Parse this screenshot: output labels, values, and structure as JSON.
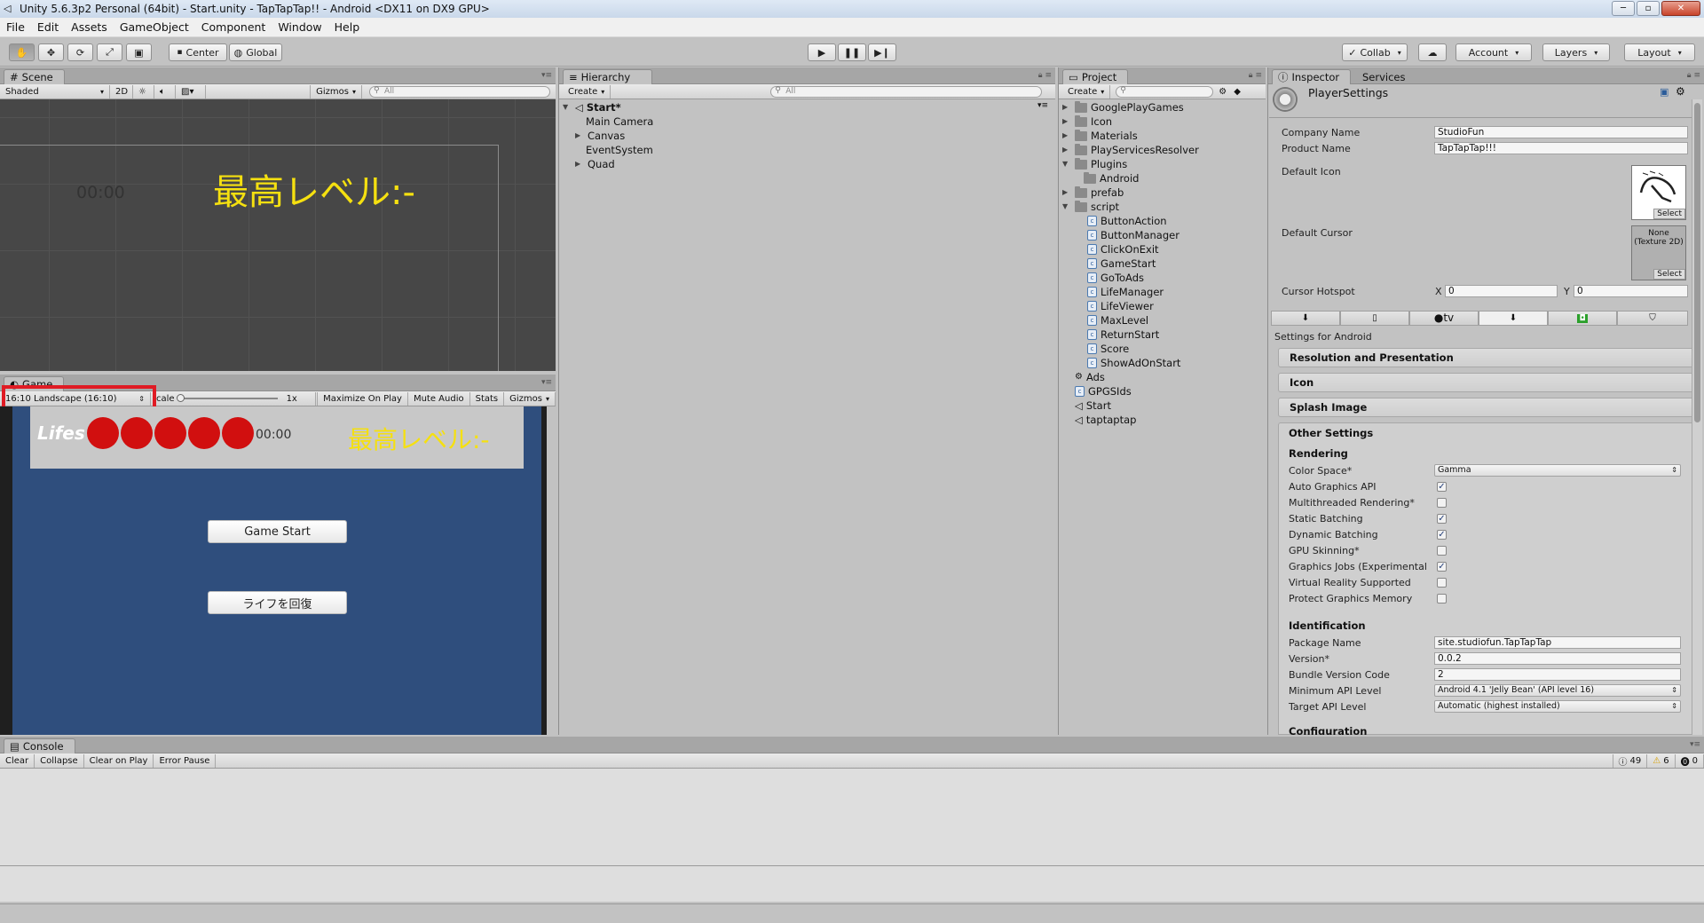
{
  "window": {
    "title": "Unity 5.6.3p2 Personal (64bit) - Start.unity - TapTapTap!! - Android <DX11 on DX9 GPU>"
  },
  "menu": [
    "File",
    "Edit",
    "Assets",
    "GameObject",
    "Component",
    "Window",
    "Help"
  ],
  "toolbar": {
    "center_label": "Center",
    "global_label": "Global",
    "collab_label": "Collab",
    "account_label": "Account",
    "layers_label": "Layers",
    "layout_label": "Layout"
  },
  "scene": {
    "tab": "Scene",
    "shading": "Shaded",
    "mode_2d": "2D",
    "gizmos": "Gizmos",
    "search_placeholder": "All",
    "time_text": "00:00",
    "level_text": "最高レベル:-"
  },
  "game": {
    "tab": "Game",
    "aspect": "16:10 Landscape (16:10)",
    "scale_label": "cale",
    "scale_value": "1x",
    "maximize": "Maximize On Play",
    "mute": "Mute Audio",
    "stats": "Stats",
    "gizmos": "Gizmos",
    "lifes_label": "Lifes",
    "life_count": 5,
    "time_text": "00:00",
    "level_text": "最高レベル:-",
    "start_button": "Game Start",
    "recover_button": "ライフを回復"
  },
  "hierarchy": {
    "tab": "Hierarchy",
    "create": "Create",
    "search_placeholder": "All",
    "scene_name": "Start*",
    "items": [
      "Main Camera",
      "Canvas",
      "EventSystem",
      "Quad"
    ]
  },
  "project": {
    "tab": "Project",
    "create": "Create",
    "folders": [
      "GooglePlayGames",
      "Icon",
      "Materials",
      "PlayServicesResolver",
      "Plugins",
      "Android",
      "prefab",
      "script"
    ],
    "scripts": [
      "ButtonAction",
      "ButtonManager",
      "ClickOnExit",
      "GameStart",
      "GoToAds",
      "LifeManager",
      "LifeViewer",
      "MaxLevel",
      "ReturnStart",
      "Score",
      "ShowAdOnStart"
    ],
    "root_items": [
      "Ads",
      "GPGSIds",
      "Start",
      "taptaptap"
    ]
  },
  "inspector": {
    "tab": "Inspector",
    "services_tab": "Services",
    "title": "PlayerSettings",
    "company_label": "Company Name",
    "company_value": "StudioFun",
    "product_label": "Product Name",
    "product_value": "TapTapTap!!!",
    "default_icon_label": "Default Icon",
    "select_label": "Select",
    "default_cursor_label": "Default Cursor",
    "cursor_none": "None (Texture 2D)",
    "hotspot_label": "Cursor Hotspot",
    "hotspot_x_label": "X",
    "hotspot_x": "0",
    "hotspot_y_label": "Y",
    "hotspot_y": "0",
    "platform_tv": "tv",
    "settings_for": "Settings for Android",
    "sections": [
      "Resolution and Presentation",
      "Icon",
      "Splash Image"
    ],
    "other_settings": "Other Settings",
    "rendering": "Rendering",
    "color_space_label": "Color Space*",
    "color_space_value": "Gamma",
    "rendering_opts": [
      {
        "label": "Auto Graphics API",
        "checked": true
      },
      {
        "label": "Multithreaded Rendering*",
        "checked": false
      },
      {
        "label": "Static Batching",
        "checked": true
      },
      {
        "label": "Dynamic Batching",
        "checked": true
      },
      {
        "label": "GPU Skinning*",
        "checked": false
      },
      {
        "label": "Graphics Jobs (Experimental",
        "checked": true
      },
      {
        "label": "Virtual Reality Supported",
        "checked": false
      },
      {
        "label": "Protect Graphics Memory",
        "checked": false
      }
    ],
    "identification": "Identification",
    "package_label": "Package Name",
    "package_value": "site.studiofun.TapTapTap",
    "version_label": "Version*",
    "version_value": "0.0.2",
    "bundle_label": "Bundle Version Code",
    "bundle_value": "2",
    "min_api_label": "Minimum API Level",
    "min_api_value": "Android 4.1 'Jelly Bean' (API level 16)",
    "target_api_label": "Target API Level",
    "target_api_value": "Automatic (highest installed)",
    "configuration": "Configuration"
  },
  "console": {
    "tab": "Console",
    "clear": "Clear",
    "collapse": "Collapse",
    "clear_on_play": "Clear on Play",
    "error_pause": "Error Pause",
    "log_count": "49",
    "warn_count": "6",
    "error_count": "0"
  }
}
